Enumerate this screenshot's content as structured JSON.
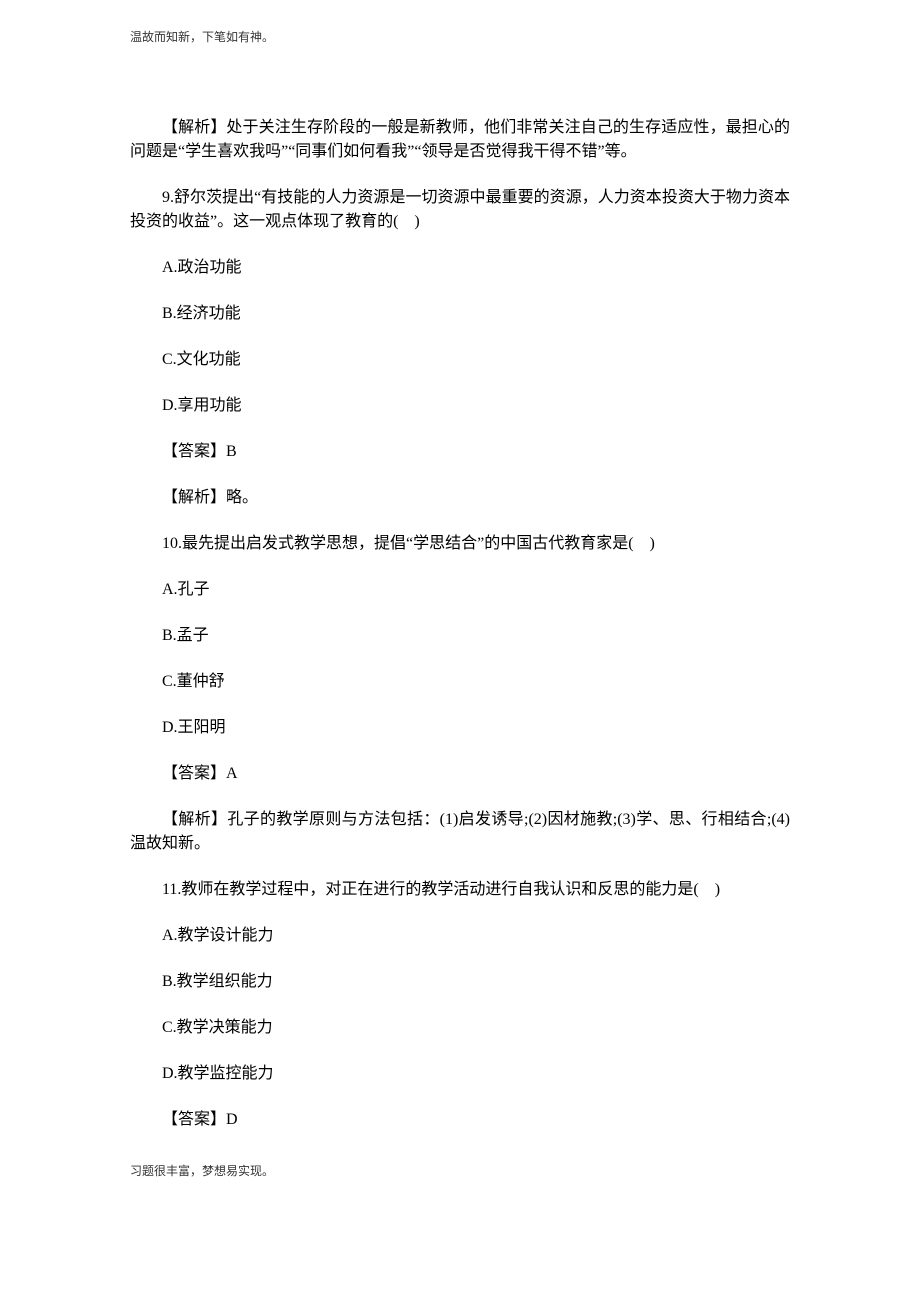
{
  "header": "温故而知新，下笔如有神。",
  "footer": "习题很丰富，梦想易实现。",
  "body": {
    "p1": "【解析】处于关注生存阶段的一般是新教师，他们非常关注自己的生存适应性，最担心的问题是“学生喜欢我吗”“同事们如何看我”“领导是否觉得我干得不错”等。",
    "q9": {
      "stem": "9.舒尔茨提出“有技能的人力资源是一切资源中最重要的资源，人力资本投资大于物力资本投资的收益”。这一观点体现了教育的(　)",
      "A": "A.政治功能",
      "B": "B.经济功能",
      "C": "C.文化功能",
      "D": "D.享用功能",
      "answer": "【答案】B",
      "analysis": "【解析】略。"
    },
    "q10": {
      "stem": "10.最先提出启发式教学思想，提倡“学思结合”的中国古代教育家是(　)",
      "A": "A.孔子",
      "B": "B.孟子",
      "C": "C.董仲舒",
      "D": "D.王阳明",
      "answer": "【答案】A",
      "analysis": "【解析】孔子的教学原则与方法包括：(1)启发诱导;(2)因材施教;(3)学、思、行相结合;(4)温故知新。"
    },
    "q11": {
      "stem": "11.教师在教学过程中，对正在进行的教学活动进行自我认识和反思的能力是(　)",
      "A": "A.教学设计能力",
      "B": "B.教学组织能力",
      "C": "C.教学决策能力",
      "D": "D.教学监控能力",
      "answer": "【答案】D"
    }
  }
}
